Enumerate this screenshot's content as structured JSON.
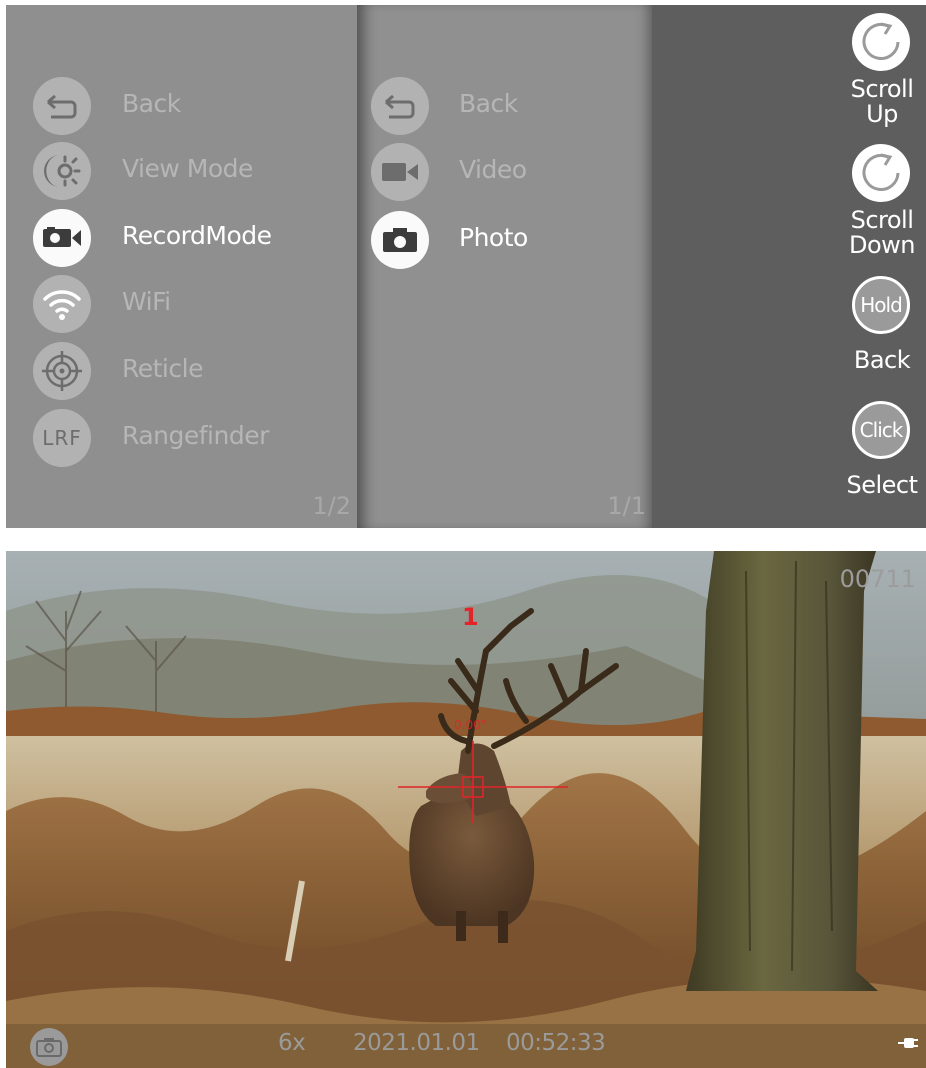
{
  "menu": {
    "main": {
      "items": [
        {
          "label": "Back",
          "icon": "back-arrow-icon"
        },
        {
          "label": "View Mode",
          "icon": "view-mode-icon"
        },
        {
          "label": "RecordMode",
          "icon": "record-mode-icon",
          "selected": true
        },
        {
          "label": "WiFi",
          "icon": "wifi-icon"
        },
        {
          "label": "Reticle",
          "icon": "reticle-icon"
        },
        {
          "label": "Rangefinder",
          "icon": "rangefinder-icon",
          "icon_text": "LRF"
        }
      ],
      "page": "1/2"
    },
    "sub": {
      "items": [
        {
          "label": "Back",
          "icon": "back-arrow-icon"
        },
        {
          "label": "Video",
          "icon": "video-camera-icon"
        },
        {
          "label": "Photo",
          "icon": "photo-camera-icon",
          "selected": true
        }
      ],
      "page": "1/1"
    },
    "hints": {
      "scroll_up_label": "Scroll\nUp",
      "scroll_down_label": "Scroll\nDown",
      "hold_icon_text": "Hold",
      "hold_label": "Back",
      "click_icon_text": "Click",
      "click_label": "Select"
    }
  },
  "viewfinder": {
    "frame_counter": "00711",
    "reticle_number": "1",
    "reticle_color": "#e2232a",
    "status": {
      "zoom": "6x",
      "date": "2021.01.01",
      "time": "00:52:33",
      "mode_icon": "photo-camera-icon",
      "power_icon": "plug-icon"
    }
  },
  "colors": {
    "panel_main": "#8f8f8f",
    "panel_side": "#5e5e5e",
    "item_inactive": "#b6b6b6",
    "item_selected": "#ffffff"
  }
}
